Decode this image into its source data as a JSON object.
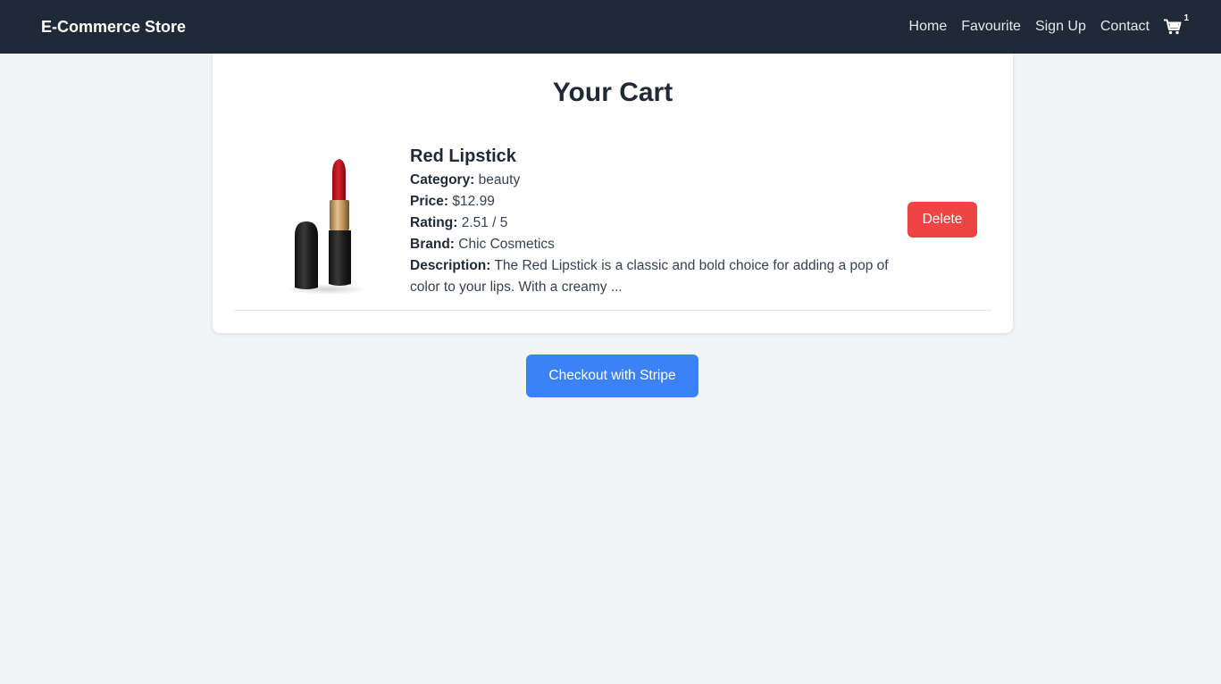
{
  "navbar": {
    "brand": "E-Commerce Store",
    "links": [
      "Home",
      "Favourite",
      "Sign Up",
      "Contact"
    ],
    "cart_icon": "shopping-cart-icon",
    "cart_count": "1"
  },
  "cart": {
    "title": "Your Cart",
    "items": [
      {
        "name": "Red Lipstick",
        "image_icon": "lipstick-product-image",
        "category_label": "Category:",
        "category": "beauty",
        "price_label": "Price:",
        "price": "$12.99",
        "rating_label": "Rating:",
        "rating": "2.51 / 5",
        "brand_label": "Brand:",
        "brand": "Chic Cosmetics",
        "description_label": "Description:",
        "description": "The Red Lipstick is a classic and bold choice for adding a pop of color to your lips. With a creamy ...",
        "delete_label": "Delete"
      }
    ],
    "checkout_label": "Checkout with Stripe"
  },
  "colors": {
    "navbar_bg": "#1f2937",
    "page_bg": "#f3f4f6",
    "delete_button": "#ef4444",
    "checkout_button": "#3b82f6"
  }
}
